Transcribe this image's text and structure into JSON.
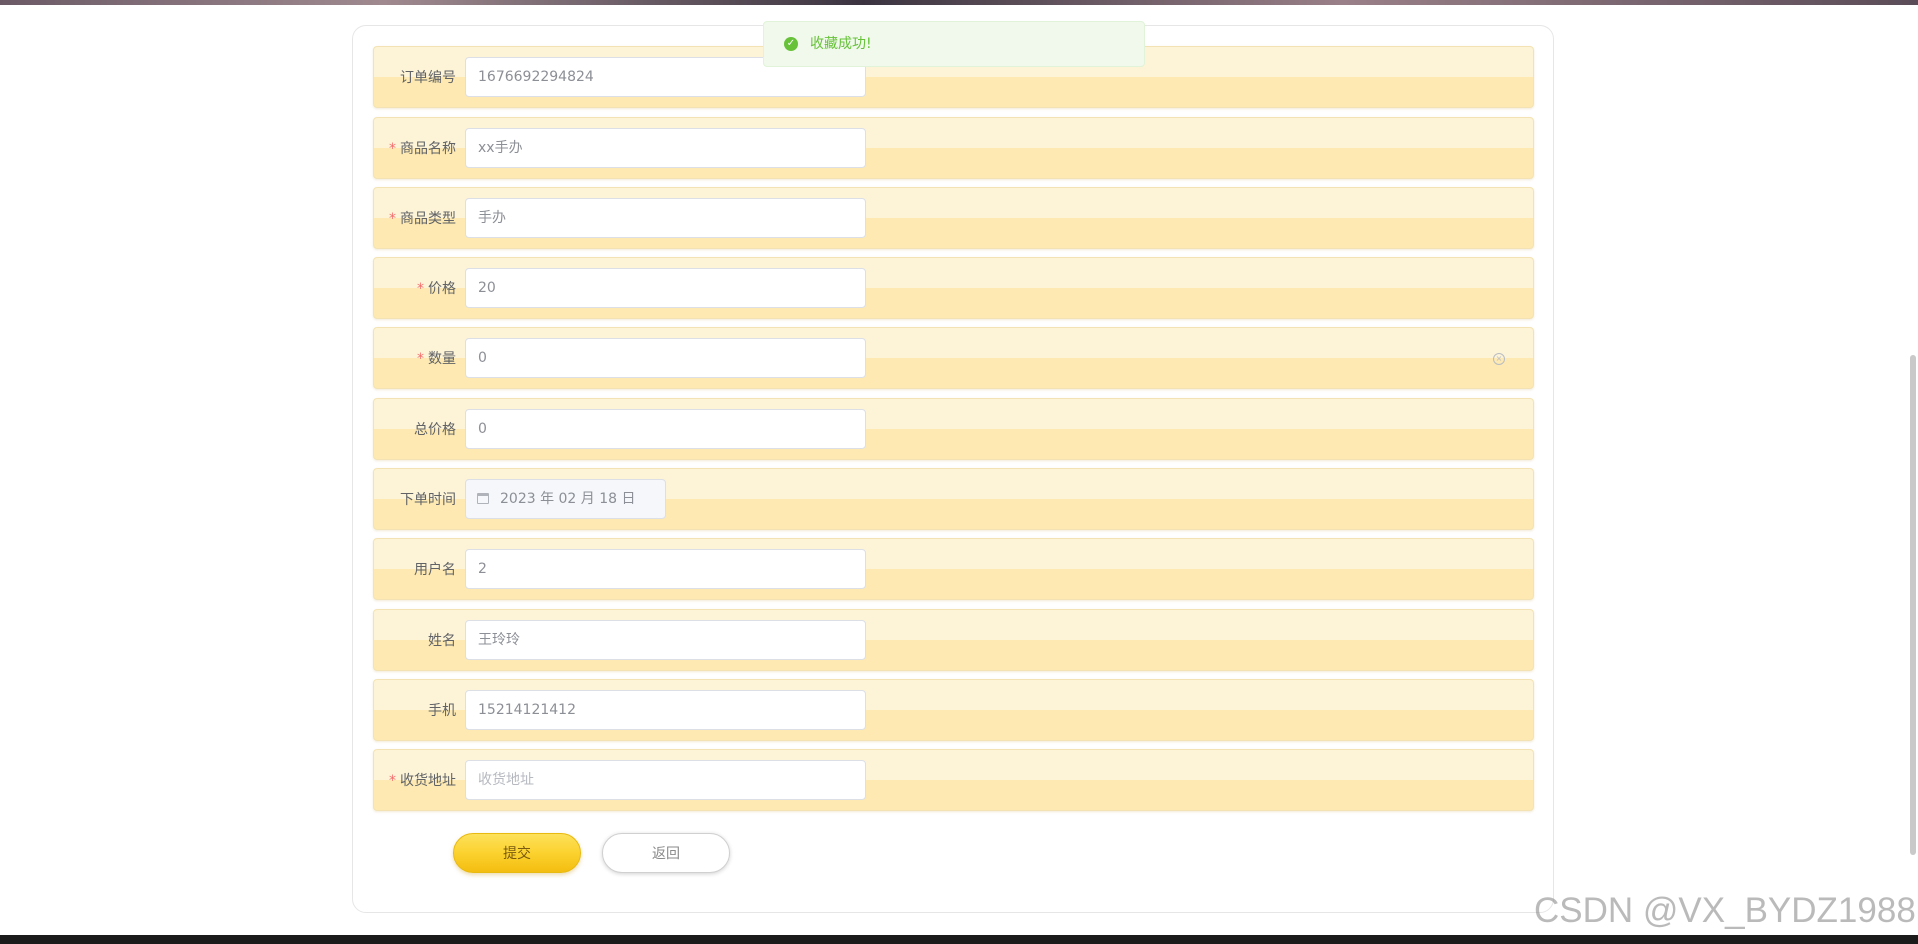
{
  "toast": {
    "message": "收藏成功!"
  },
  "form": {
    "rows": [
      {
        "label": "订单编号",
        "required": "",
        "value": "1676692294824"
      },
      {
        "label": "商品名称",
        "required": "*",
        "value": "xx手办"
      },
      {
        "label": "商品类型",
        "required": "*",
        "value": "手办"
      },
      {
        "label": "价格",
        "required": "*",
        "value": "20"
      },
      {
        "label": "数量",
        "required": "*",
        "value": "0"
      },
      {
        "label": "总价格",
        "required": "",
        "value": "0"
      },
      {
        "label": "下单时间",
        "required": "",
        "value": "2023 年 02 月 18 日"
      },
      {
        "label": "用户名",
        "required": "",
        "value": "2"
      },
      {
        "label": "姓名",
        "required": "",
        "value": "王玲玲"
      },
      {
        "label": "手机",
        "required": "",
        "value": "15214121412"
      },
      {
        "label": "收货地址",
        "required": "*",
        "value": "",
        "placeholder": "收货地址"
      }
    ]
  },
  "buttons": {
    "submit": "提交",
    "back": "返回"
  },
  "icons": {
    "toast": "check-circle-icon",
    "date": "calendar-icon",
    "clear": "clear-circle-icon"
  },
  "watermark": "CSDN @VX_BYDZ1988",
  "colors": {
    "accent": "#fbd22f",
    "success": "#67c23a",
    "required": "#f56c6c",
    "row_bg": "#fdf3d7"
  }
}
